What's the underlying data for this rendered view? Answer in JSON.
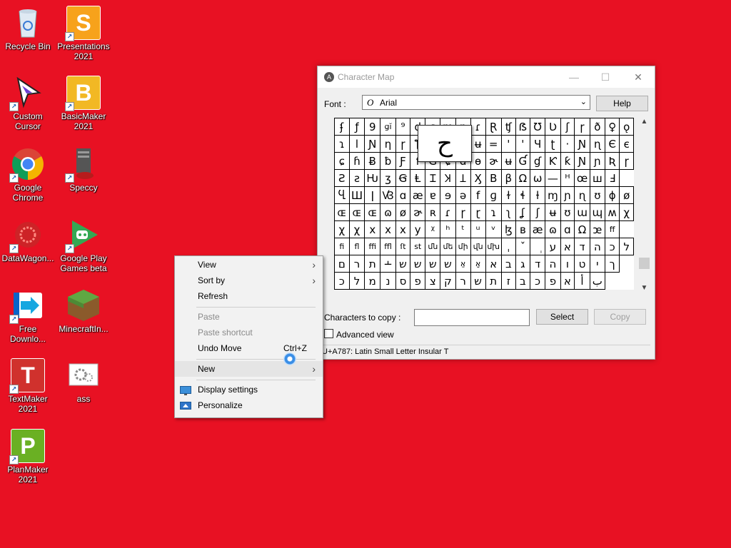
{
  "desktop": {
    "icons": [
      {
        "label": "Recycle Bin",
        "icon": "recycle-bin-icon"
      },
      {
        "label": "Presentations\n2021",
        "icon": "presentations-icon",
        "glyph": "S",
        "color": "#f7a21b"
      },
      {
        "label": "Custom\nCursor",
        "icon": "custom-cursor-icon"
      },
      {
        "label": "BasicMaker\n2021",
        "icon": "basicmaker-icon",
        "glyph": "B",
        "color": "#f2b824"
      },
      {
        "label": "Google\nChrome",
        "icon": "chrome-icon"
      },
      {
        "label": "Speccy",
        "icon": "speccy-icon"
      },
      {
        "label": "DataWagon...",
        "icon": "datawagon-icon"
      },
      {
        "label": "Google Play\nGames beta",
        "icon": "google-play-games-icon"
      },
      {
        "label": "Free\nDownlo...",
        "icon": "free-download-icon"
      },
      {
        "label": "MinecraftIn...",
        "icon": "minecraft-icon"
      },
      {
        "label": "TextMaker\n2021",
        "icon": "textmaker-icon",
        "glyph": "T",
        "color": "#d0312d"
      },
      {
        "label": "ass",
        "icon": "settings-file-icon"
      },
      {
        "label": "PlanMaker\n2021",
        "icon": "planmaker-icon",
        "glyph": "P",
        "color": "#6ab023"
      }
    ]
  },
  "charmap": {
    "title": "Character Map",
    "font_label": "Font :",
    "font_value": "Arial",
    "font_icon_glyph": "O",
    "help_label": "Help",
    "zoom_char": "ح",
    "grid": [
      [
        "ʄ",
        "ƒ",
        "9",
        "ցĭ",
        "⁹",
        "d",
        "ʂ",
        "m",
        "p",
        "ɾ",
        "Ɽ",
        "ʧ",
        "ẞ",
        "Ʊ",
        "Ʋ",
        "ʃ",
        "ɼ",
        "ð",
        "♀",
        "ǫ"
      ],
      [
        "ɿ",
        "l",
        "Ɲ",
        "ƞ",
        "ɼ",
        "ƪ",
        "ɑ",
        "ɨ",
        "ʇ",
        "ʉ",
        "=",
        "'",
        "'",
        "Ч",
        "ʈ",
        "·",
        "Ɲ",
        "ɳ",
        "Є",
        "є"
      ],
      [
        "ɕ",
        "ɦ",
        "Ƀ",
        "ƀ",
        "Ƒ",
        "f",
        "Ɠ",
        "ɕ",
        "ɑ",
        "ɵ",
        "ɚ",
        "ʉ",
        "Ɠ",
        "ɠ",
        "Ƙ",
        "ƙ",
        "Ɲ",
        "ɲ",
        "Ʀ",
        "ɼ"
      ],
      [
        "Ƨ",
        "ƨ",
        "Ƕ",
        "ʒ",
        "Ꞡ",
        "Ⱡ",
        "Ɪ",
        "Ʞ",
        "Ʇ",
        "Ӽ",
        "Β",
        "β",
        "Ω",
        "ω",
        "—",
        "ᵸ",
        "œ",
        "ꟺ",
        "Ⅎ"
      ],
      [
        "Ⴁ",
        "Ш",
        "ǀ",
        "Ꟃ",
        "ɑ",
        "æ",
        "ɐ",
        "ɘ",
        "ə",
        "f",
        "ɡ",
        "ɫ",
        "ɬ",
        "ƚ",
        "ɱ",
        "ɲ",
        "ɳ",
        "ʊ",
        "ɸ",
        "ø"
      ],
      [
        "ɶ",
        "ɶ",
        "ɶ",
        "ɷ",
        "ø",
        "ɚ",
        "ʀ",
        "ɾ",
        "ɼ",
        "ɽ",
        "ɿ",
        "ʅ",
        "ʆ",
        "ʃ",
        "ʉ",
        "ʊ",
        "ɯ",
        "ɰ",
        "ʍ",
        "χ"
      ],
      [
        "χ",
        "χ",
        "x",
        "x",
        "x",
        "y",
        "ᵡ",
        "ʰ",
        "ᵗ",
        "ᵘ",
        "ᵛ",
        "ɮ",
        "ʙ",
        "æ",
        "ɷ",
        "ɑ",
        "Ω",
        "ꭢ",
        "ff"
      ],
      [
        "fi",
        "fl",
        "ffi",
        "ffl",
        "ſt",
        "st",
        "մն",
        "մե",
        "մի",
        "վն",
        "մխ",
        "ˌ",
        "ˇ",
        "ְ",
        "ע",
        "א",
        "ד",
        "ה",
        "כ",
        "ל"
      ],
      [
        "ם",
        "ר",
        "ת",
        "﬩",
        "ש",
        "ש",
        "ש",
        "ש",
        "אַ",
        "אָ",
        "א",
        "ב",
        "ג",
        "ד",
        "ה",
        "ו",
        "ט",
        "י",
        "ך"
      ],
      [
        "כ",
        "ל",
        "מ",
        "נ",
        "ס",
        "פ",
        "צ",
        "ק",
        "ר",
        "ש",
        "ת",
        "ז",
        "ב",
        "כ",
        "פ",
        "א",
        "أ",
        "ب"
      ]
    ],
    "copy_label": "Characters to copy :",
    "copy_value": "",
    "select_label": "Select",
    "copy_button_label": "Copy",
    "advanced_label": "Advanced view",
    "status": "U+A787: Latin Small Letter Insular T"
  },
  "context_menu": {
    "items": [
      {
        "label": "View",
        "submenu": true
      },
      {
        "label": "Sort by",
        "submenu": true
      },
      {
        "label": "Refresh"
      },
      {
        "label": "Paste",
        "disabled": true
      },
      {
        "label": "Paste shortcut",
        "disabled": true
      },
      {
        "label": "Undo Move",
        "shortcut": "Ctrl+Z"
      },
      {
        "label": "New",
        "submenu": true
      },
      {
        "label": "Display settings",
        "icon": "display-settings-icon"
      },
      {
        "label": "Personalize",
        "icon": "personalize-icon"
      }
    ]
  },
  "colors": {
    "desktop_bg": "#e81123"
  }
}
